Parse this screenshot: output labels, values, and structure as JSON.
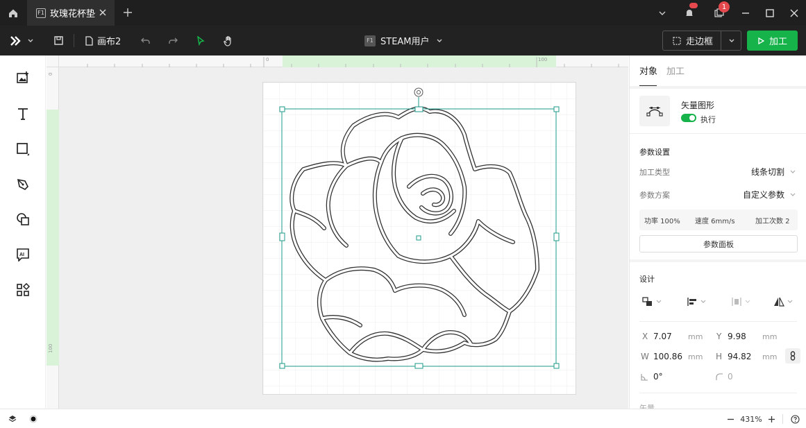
{
  "titlebar": {
    "tab_badge": "F1",
    "tab_title": "玫瑰花杯垫",
    "notif_count": "1"
  },
  "toolbar": {
    "canvas_name": "画布2",
    "user_badge": "F1",
    "user_label": "STEAM用户",
    "frame_label": "走边框",
    "process_label": "加工"
  },
  "ruler": {
    "top_labels": [
      "0",
      "100"
    ],
    "left_labels": [
      "0",
      "100"
    ]
  },
  "panel": {
    "tabs": [
      "对象",
      "加工"
    ],
    "object_type": "矢量图形",
    "execute_label": "执行",
    "param_section": "参数设置",
    "process_type_label": "加工类型",
    "process_type_value": "线条切割",
    "param_scheme_label": "参数方案",
    "param_scheme_value": "自定义参数",
    "power": "功率 100%",
    "speed": "速度 6mm/s",
    "passes": "加工次数 2",
    "param_panel_btn": "参数面板",
    "design_section": "设计",
    "x_label": "X",
    "x_value": "7.07",
    "x_unit": "mm",
    "y_label": "Y",
    "y_value": "9.98",
    "y_unit": "mm",
    "w_label": "W",
    "w_value": "100.86",
    "w_unit": "mm",
    "h_label": "H",
    "h_value": "94.82",
    "h_unit": "mm",
    "angle_value": "0°",
    "radius_value": "0",
    "cut_section": "矢量"
  },
  "status": {
    "zoom": "431%"
  },
  "colors": {
    "accent": "#16b24a",
    "selection": "#1a9a8a",
    "badge": "#e5484d"
  }
}
